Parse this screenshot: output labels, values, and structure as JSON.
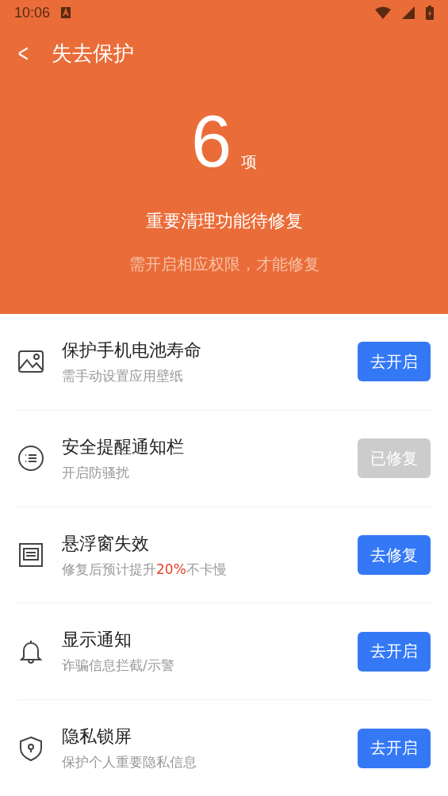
{
  "status_bar": {
    "time": "10:06"
  },
  "toolbar": {
    "back": "<",
    "title": "失去保护"
  },
  "summary": {
    "count": "6",
    "unit": "项",
    "headline": "重要清理功能待修复",
    "note": "需开启相应权限，才能修复"
  },
  "items": [
    {
      "kind": "image",
      "title": "保护手机电池寿命",
      "subtitle": [
        {
          "text": "需手动设置应用壁纸",
          "highlight": false
        }
      ],
      "button": {
        "label": "去开启",
        "disabled": false
      }
    },
    {
      "kind": "list",
      "title": "安全提醒通知栏",
      "subtitle": [
        {
          "text": "开启防骚扰",
          "highlight": false
        }
      ],
      "button": {
        "label": "已修复",
        "disabled": true
      }
    },
    {
      "kind": "window",
      "title": "悬浮窗失效",
      "subtitle": [
        {
          "text": "修复后预计提升",
          "highlight": false
        },
        {
          "text": "20%",
          "highlight": true
        },
        {
          "text": "不卡慢",
          "highlight": false
        }
      ],
      "button": {
        "label": "去修复",
        "disabled": false
      }
    },
    {
      "kind": "bell",
      "title": "显示通知",
      "subtitle": [
        {
          "text": "诈骗信息拦截/示警",
          "highlight": false
        }
      ],
      "button": {
        "label": "去开启",
        "disabled": false
      }
    },
    {
      "kind": "shield",
      "title": "隐私锁屏",
      "subtitle": [
        {
          "text": "保护个人重要隐私信息",
          "highlight": false
        }
      ],
      "button": {
        "label": "去开启",
        "disabled": false
      }
    }
  ]
}
